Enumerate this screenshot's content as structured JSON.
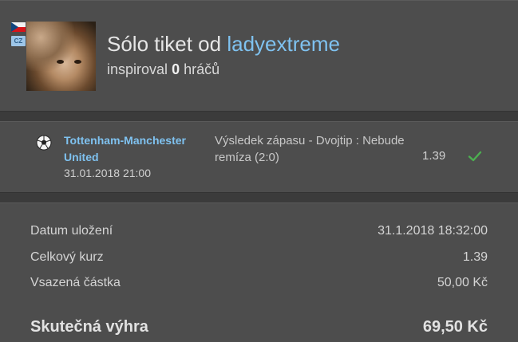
{
  "header": {
    "title_prefix": "Sólo tiket od",
    "username": "ladyextreme",
    "inspired_prefix": "inspiroval",
    "inspired_count": "0",
    "inspired_suffix": "hráčů",
    "country_code": "CZ"
  },
  "bet": {
    "sport_icon": "soccer-ball-icon",
    "match": "Tottenham-Manchester United",
    "date": "31.01.2018 21:00",
    "description": "Výsledek zápasu - Dvojtip : Nebude remíza (2:0)",
    "odds": "1.39",
    "status_icon": "check-icon",
    "status_color": "#4caf50"
  },
  "summary": {
    "rows": [
      {
        "label": "Datum uložení",
        "value": "31.1.2018 18:32:00"
      },
      {
        "label": "Celkový kurz",
        "value": "1.39"
      },
      {
        "label": "Vsazená částka",
        "value": "50,00 Kč"
      }
    ],
    "total_label": "Skutečná výhra",
    "total_value": "69,50 Kč"
  },
  "colors": {
    "background": "#3b3b3b",
    "panel": "#4d4d4d",
    "link": "#7fc2f0"
  }
}
